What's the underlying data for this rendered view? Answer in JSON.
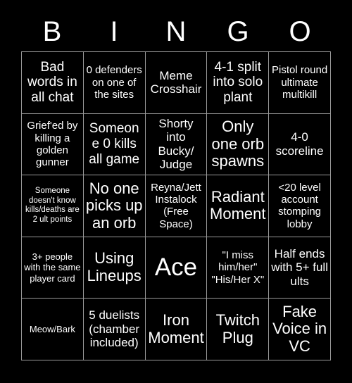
{
  "card": {
    "title": "BINGO",
    "header_letters": [
      "B",
      "I",
      "N",
      "G",
      "O"
    ],
    "colors": {
      "background": "#000000",
      "cell_background": "#000000",
      "text": "#ffffff",
      "gridline": "#9a9a9a"
    },
    "grid_size": "5x5",
    "free_space_index": 12,
    "cells": [
      {
        "text": "Bad words in all chat",
        "size": "lg"
      },
      {
        "text": "0 defenders on one of the sites",
        "size": "sm"
      },
      {
        "text": "Meme Crosshair",
        "size": "md"
      },
      {
        "text": "4-1 split into solo plant",
        "size": "lg"
      },
      {
        "text": "Pistol round ultimate multikill",
        "size": "sm"
      },
      {
        "text": "Grief'ed by killing a golden gunner",
        "size": "sm"
      },
      {
        "text": "Someone 0 kills all game",
        "size": "lg"
      },
      {
        "text": "Shorty into Bucky/ Judge",
        "size": "md"
      },
      {
        "text": "Only one orb spawns",
        "size": "xl"
      },
      {
        "text": "4-0 scoreline",
        "size": "md"
      },
      {
        "text": "Someone doesn't know kills/deaths are 2 ult points",
        "size": "xxs"
      },
      {
        "text": "No one picks up an orb",
        "size": "xl"
      },
      {
        "text": "Reyna/Jett Instalock (Free Space)",
        "size": "sm"
      },
      {
        "text": "Radiant Moment",
        "size": "xl"
      },
      {
        "text": "<20 level account stomping lobby",
        "size": "sm"
      },
      {
        "text": "3+ people with the same player card",
        "size": "xs"
      },
      {
        "text": "Using Lineups",
        "size": "xl"
      },
      {
        "text": "Ace",
        "size": "xxl"
      },
      {
        "text": "\"I miss him/her\" \"His/Her X\"",
        "size": "sm"
      },
      {
        "text": "Half ends with 5+ full ults",
        "size": "md"
      },
      {
        "text": "Meow/Bark",
        "size": "xs"
      },
      {
        "text": "5 duelists (chamber included)",
        "size": "md"
      },
      {
        "text": "Iron Moment",
        "size": "xl"
      },
      {
        "text": "Twitch Plug",
        "size": "xl"
      },
      {
        "text": "Fake Voice in VC",
        "size": "xl"
      }
    ]
  }
}
